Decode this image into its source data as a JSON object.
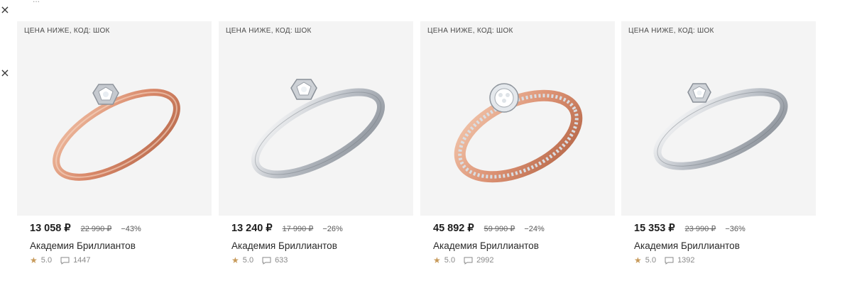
{
  "window": {
    "close_icon_1": "×",
    "close_icon_2": "×",
    "top_cropped_text": "..."
  },
  "colors": {
    "card_bg": "#f4f4f4",
    "star": "#c79a5a",
    "rose_gold": "#d99677",
    "white_gold": "#c9ccd1"
  },
  "products": [
    {
      "badge": "ЦЕНА НИЖЕ, КОД: ШОК",
      "price": "13 058 ₽",
      "old_price": "22 990 ₽",
      "discount": "−43%",
      "brand": "Академия Бриллиантов",
      "rating": "5.0",
      "reviews": "1447",
      "star_icon": "★",
      "ring_icon": "rose-gold-solitaire-ring-icon"
    },
    {
      "badge": "ЦЕНА НИЖЕ, КОД: ШОК",
      "price": "13 240 ₽",
      "old_price": "17 990 ₽",
      "discount": "−26%",
      "brand": "Академия Бриллиантов",
      "rating": "5.0",
      "reviews": "633",
      "star_icon": "★",
      "ring_icon": "white-gold-solitaire-ring-icon"
    },
    {
      "badge": "ЦЕНА НИЖЕ, КОД: ШОК",
      "price": "45 892 ₽",
      "old_price": "59 990 ₽",
      "discount": "−24%",
      "brand": "Академия Бриллиантов",
      "rating": "5.0",
      "reviews": "2992",
      "star_icon": "★",
      "ring_icon": "rose-gold-halo-ring-icon"
    },
    {
      "badge": "ЦЕНА НИЖЕ, КОД: ШОК",
      "price": "15 353 ₽",
      "old_price": "23 990 ₽",
      "discount": "−36%",
      "brand": "Академия Бриллиантов",
      "rating": "5.0",
      "reviews": "1392",
      "star_icon": "★",
      "ring_icon": "white-gold-twist-ring-icon"
    }
  ]
}
